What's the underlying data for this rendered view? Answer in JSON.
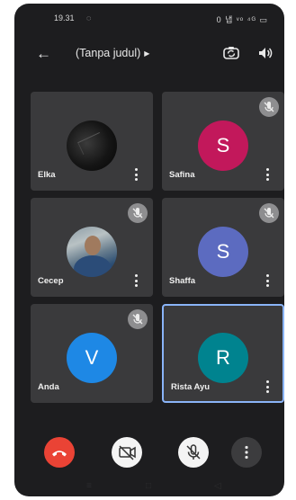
{
  "status_bar": {
    "time": "19.31",
    "indicators": "0 냅 ᵛᵒ ⁴ᴳ ▭"
  },
  "app_bar": {
    "title": "(Tanpa judul)"
  },
  "participants": [
    {
      "name": "Elka",
      "avatar_type": "photo",
      "muted": false
    },
    {
      "name": "Safina",
      "avatar_type": "letter",
      "initial": "S",
      "color": "#c2185b",
      "muted": true
    },
    {
      "name": "Cecep",
      "avatar_type": "photo",
      "muted": true
    },
    {
      "name": "Shaffa",
      "avatar_type": "letter",
      "initial": "S",
      "color": "#5c6bc0",
      "muted": true
    },
    {
      "name": "Anda",
      "avatar_type": "letter",
      "initial": "V",
      "color": "#1e88e5",
      "muted": true
    },
    {
      "name": "Rista Ayu",
      "avatar_type": "letter",
      "initial": "R",
      "color": "#00838f",
      "muted": false,
      "active_speaker": true
    }
  ],
  "controls": [
    "end-call",
    "camera-off",
    "mic-off",
    "more-options"
  ],
  "colors": {
    "background": "#1d1d1f",
    "tile": "#3a3a3c",
    "active_border": "#8ab4f8",
    "end_call": "#ea4335"
  }
}
